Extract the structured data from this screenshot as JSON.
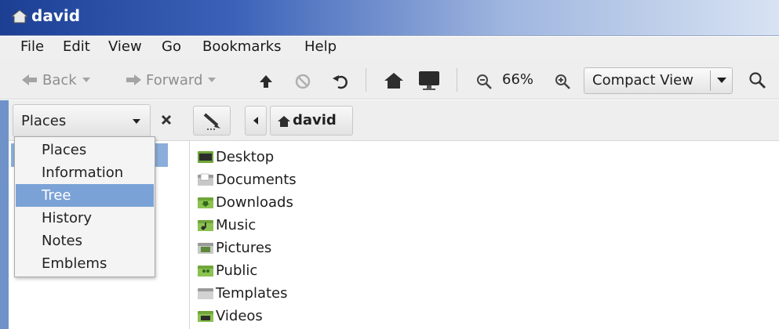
{
  "window": {
    "title": "david"
  },
  "menu": [
    "File",
    "Edit",
    "View",
    "Go",
    "Bookmarks",
    "Help"
  ],
  "toolbar": {
    "back_label": "Back",
    "forward_label": "Forward",
    "zoom_level": "66%",
    "view_mode": "Compact View"
  },
  "sidebar": {
    "selector_value": "Places",
    "options": [
      "Places",
      "Information",
      "Tree",
      "History",
      "Notes",
      "Emblems"
    ],
    "selected_option": "Tree"
  },
  "location": {
    "breadcrumb": "david"
  },
  "files": [
    {
      "name": "Desktop",
      "icon": "desktop-folder-icon"
    },
    {
      "name": "Documents",
      "icon": "documents-folder-icon"
    },
    {
      "name": "Downloads",
      "icon": "downloads-folder-icon"
    },
    {
      "name": "Music",
      "icon": "music-folder-icon"
    },
    {
      "name": "Pictures",
      "icon": "pictures-folder-icon"
    },
    {
      "name": "Public",
      "icon": "public-folder-icon"
    },
    {
      "name": "Templates",
      "icon": "templates-folder-icon"
    },
    {
      "name": "Videos",
      "icon": "videos-folder-icon"
    }
  ],
  "colors": {
    "titlebar_start": "#1c3f94",
    "selection": "#7aa2d6",
    "folder_green": "#6fa53a"
  }
}
